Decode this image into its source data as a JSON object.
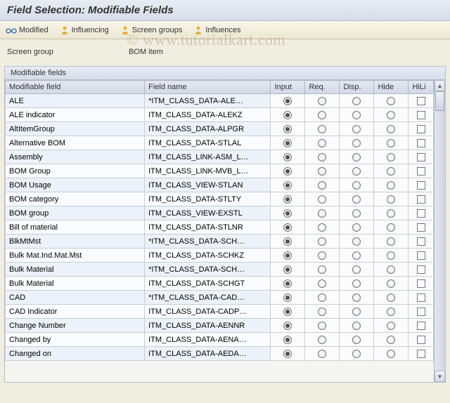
{
  "title": "Field Selection: Modifiable Fields",
  "watermark": "© www.tutorialkart.com",
  "toolbar": {
    "modified": "Modified",
    "influencing": "Influencing",
    "screen_groups": "Screen groups",
    "influences": "Influences"
  },
  "info": {
    "label": "Screen group",
    "value": "BOM item"
  },
  "panel_title": "Modifiable fields",
  "columns": {
    "field": "Modifiable field",
    "name": "Field name",
    "input": "Input",
    "req": "Req.",
    "disp": "Disp.",
    "hide": "Hide",
    "hili": "HiLi"
  },
  "rows": [
    {
      "field": "ALE",
      "name": "*ITM_CLASS_DATA-ALE…",
      "selected": 0
    },
    {
      "field": "ALE indicator",
      "name": "ITM_CLASS_DATA-ALEKZ",
      "selected": 0
    },
    {
      "field": "AltItemGroup",
      "name": "ITM_CLASS_DATA-ALPGR",
      "selected": 0
    },
    {
      "field": "Alternative BOM",
      "name": "ITM_CLASS_DATA-STLAL",
      "selected": 0
    },
    {
      "field": "Assembly",
      "name": "ITM_CLASS_LINK-ASM_L…",
      "selected": 0
    },
    {
      "field": "BOM Group",
      "name": "ITM_CLASS_LINK-MVB_L…",
      "selected": 0
    },
    {
      "field": "BOM Usage",
      "name": "ITM_CLASS_VIEW-STLAN",
      "selected": 0
    },
    {
      "field": "BOM category",
      "name": "ITM_CLASS_DATA-STLTY",
      "selected": 0
    },
    {
      "field": "BOM group",
      "name": "ITM_CLASS_VIEW-EXSTL",
      "selected": 0
    },
    {
      "field": "Bill of material",
      "name": "ITM_CLASS_DATA-STLNR",
      "selected": 0
    },
    {
      "field": "BlkMtMst",
      "name": "*ITM_CLASS_DATA-SCH…",
      "selected": 0
    },
    {
      "field": "Bulk Mat.Ind.Mat.Mst",
      "name": "ITM_CLASS_DATA-SCHKZ",
      "selected": 0
    },
    {
      "field": "Bulk Material",
      "name": "*ITM_CLASS_DATA-SCH…",
      "selected": 0
    },
    {
      "field": "Bulk Material",
      "name": "ITM_CLASS_DATA-SCHGT",
      "selected": 0
    },
    {
      "field": "CAD",
      "name": "*ITM_CLASS_DATA-CAD…",
      "selected": 0
    },
    {
      "field": "CAD Indicator",
      "name": "ITM_CLASS_DATA-CADP…",
      "selected": 0
    },
    {
      "field": "Change Number",
      "name": "ITM_CLASS_DATA-AENNR",
      "selected": 0
    },
    {
      "field": "Changed by",
      "name": "ITM_CLASS_DATA-AENA…",
      "selected": 0
    },
    {
      "field": "Changed on",
      "name": "ITM_CLASS_DATA-AEDA…",
      "selected": 0
    }
  ]
}
